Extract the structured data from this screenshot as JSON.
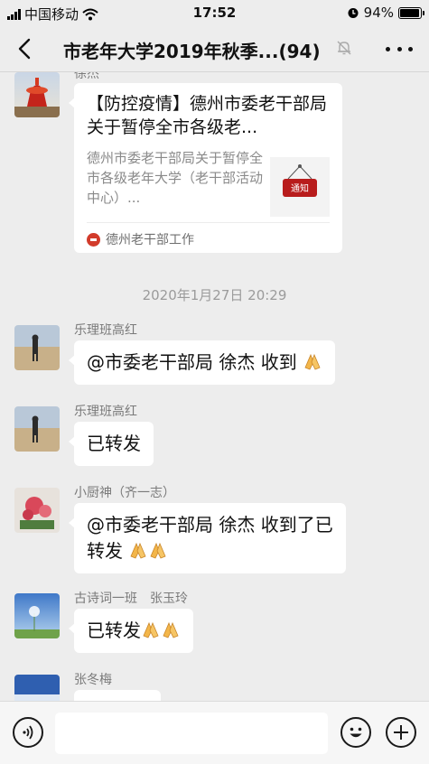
{
  "status_bar": {
    "carrier": "中国移动",
    "time": "17:52",
    "battery": "94%",
    "battery_level": 0.94
  },
  "nav": {
    "title": "市老年大学2019年秋季...",
    "count": "(94)",
    "icons": [
      "back-icon",
      "mute-bell-icon",
      "more-icon"
    ]
  },
  "messages": {
    "card": {
      "sender_partial": "徐杰",
      "title": "【防控疫情】德州市委老干部局关于暂停全市各级老...",
      "desc": "德州市委老干部局关于暂停全市各级老年大学（老干部活动中心）...",
      "thumb_text": "通知",
      "source": "德州老干部工作"
    },
    "timestamp": "2020年1月27日 20:29",
    "m1": {
      "sender": "乐理班高红",
      "text": "@市委老干部局 徐杰 收到"
    },
    "m2": {
      "sender": "乐理班高红",
      "text": "已转发"
    },
    "m3": {
      "sender": "小厨神（齐一志）",
      "line1": "@市委老干部局 徐杰 收到了已",
      "line2": "转发"
    },
    "m4": {
      "sender": "古诗词一班　张玉玲",
      "text": "已转发"
    },
    "m5": {
      "sender": "张冬梅"
    }
  },
  "input_bar": {
    "icons": [
      "voice-icon",
      "emoji-icon",
      "plus-icon"
    ]
  },
  "colors": {
    "background": "#ededed",
    "bubble": "#ffffff",
    "source_red": "#d23b2b"
  }
}
